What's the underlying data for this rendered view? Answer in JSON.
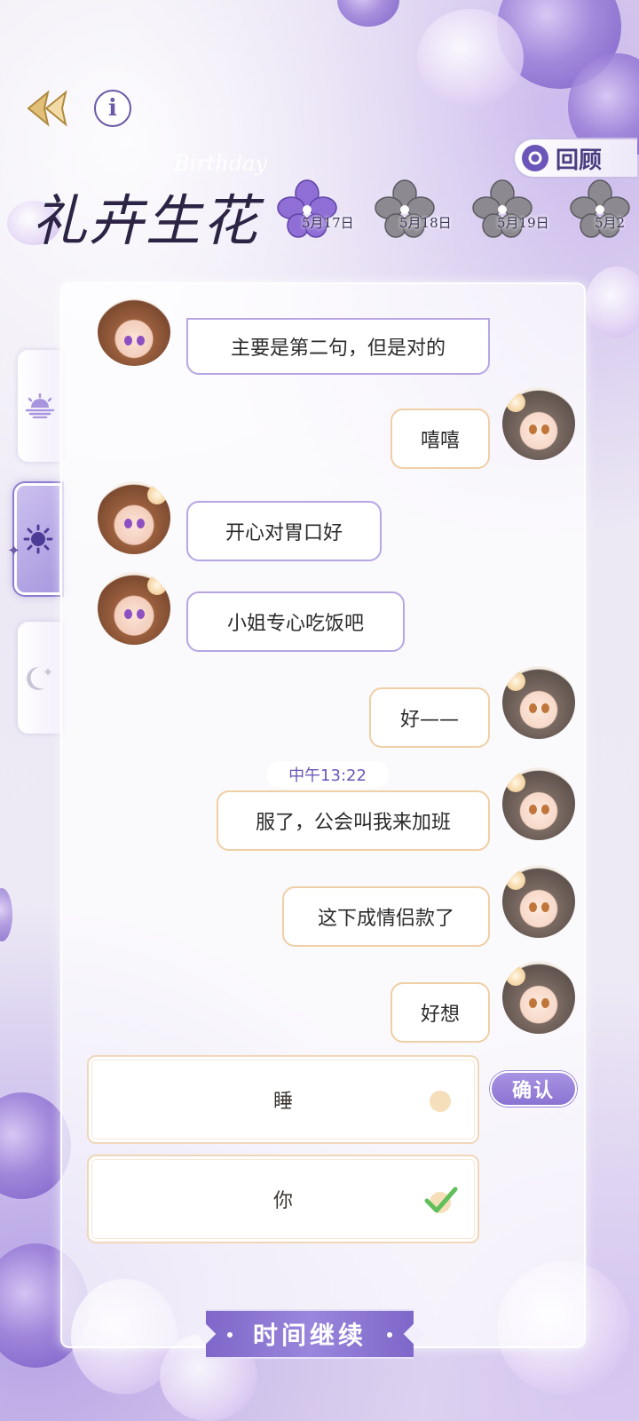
{
  "header": {
    "logo_title": "礼卉生花",
    "logo_subtitle": "Birthday",
    "review_label": "回顾",
    "info_glyph": "i"
  },
  "dates": [
    {
      "label": "5月17日",
      "active": true
    },
    {
      "label": "5月18日",
      "active": false
    },
    {
      "label": "5月19日",
      "active": false
    },
    {
      "label": "5月2",
      "active": false
    }
  ],
  "side_tabs": [
    {
      "name": "sunrise-icon",
      "active": false
    },
    {
      "name": "sun-icon",
      "active": true
    },
    {
      "name": "moon-icon",
      "active": false
    }
  ],
  "chat": {
    "time_divider": "中午13:22",
    "messages": [
      {
        "from": "them",
        "text": "主要是第二句，但是对的"
      },
      {
        "from": "me",
        "text": "嘻嘻"
      },
      {
        "from": "them",
        "text": "开心对胃口好"
      },
      {
        "from": "them",
        "text": "小姐专心吃饭吧"
      },
      {
        "from": "me",
        "text": "好——"
      },
      {
        "from": "me",
        "text": "服了，公会叫我来加班"
      },
      {
        "from": "me",
        "text": "这下成情侣款了"
      },
      {
        "from": "me",
        "text": "好想"
      }
    ]
  },
  "options": [
    {
      "label": "睡",
      "selected": false
    },
    {
      "label": "你",
      "selected": true
    }
  ],
  "confirm_label": "确认",
  "continue_label": "时间继续",
  "colors": {
    "accent": "#8b74d2",
    "them_border": "#b7a6e3",
    "me_border": "#efcfa6",
    "time_text": "#6a58b8"
  }
}
